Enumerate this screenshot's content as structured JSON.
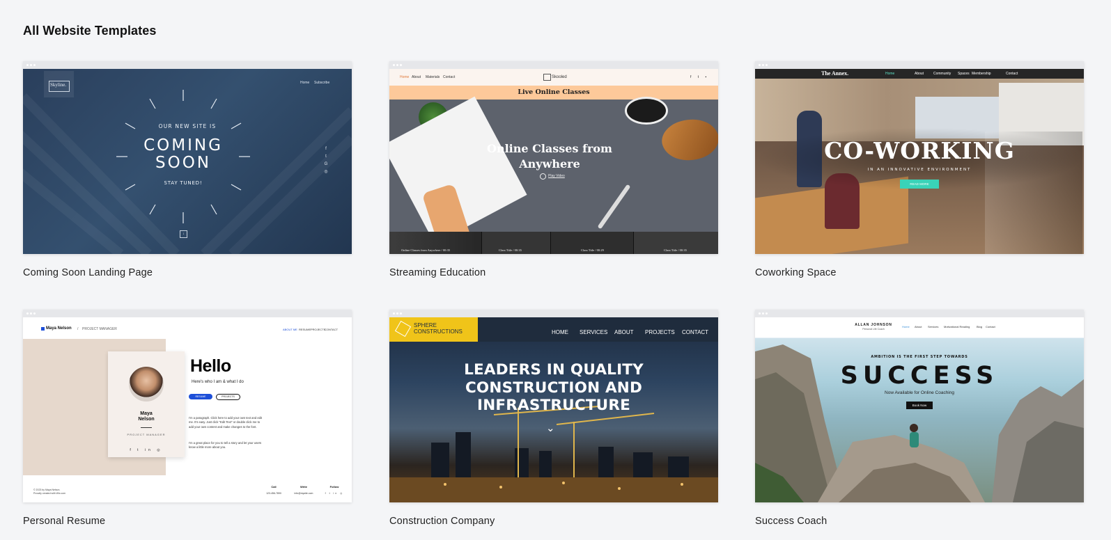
{
  "page": {
    "title": "All Website Templates"
  },
  "templates": [
    {
      "label": "Coming Soon Landing Page",
      "preview": {
        "logo": "Skyline.",
        "nav": [
          "Home",
          "Subscribe"
        ],
        "kicker": "OUR NEW SITE IS",
        "headline": [
          "COMING",
          "SOON"
        ],
        "tagline": "STAY TUNED!",
        "colors": {
          "bg": "#2b4260"
        }
      }
    },
    {
      "label": "Streaming Education",
      "preview": {
        "nav": [
          "Home",
          "About",
          "Materials",
          "Contact"
        ],
        "brand": "Skooled",
        "banner": "Live Online Classes",
        "headline": [
          "Online Classes from",
          "Anywhere"
        ],
        "cta": "Play Video",
        "strip": [
          "Online Classes from Anywhere / 00:35",
          "Class Title / 00:35",
          "Class Title / 00:29",
          "Class Title / 00:35"
        ],
        "colors": {
          "banner": "#fdc99a",
          "bg": "#5d626c"
        }
      }
    },
    {
      "label": "Coworking Space",
      "preview": {
        "brand": "The Annex.",
        "nav": [
          "Home",
          "About",
          "Community",
          "Spaces",
          "Membership",
          "Contact"
        ],
        "headline": "CO-WORKING",
        "subline": "IN AN INNOVATIVE ENVIRONMENT",
        "cta": "READ MORE",
        "colors": {
          "cta": "#3ad3b8"
        }
      }
    },
    {
      "label": "Personal Resume",
      "preview": {
        "name": "Maya Nelson",
        "role": "PROJECT MANAGER",
        "nav": [
          "ABOUT ME",
          "RESUME",
          "PROJECTS",
          "CONTACT"
        ],
        "card_name": [
          "Maya",
          "Nelson"
        ],
        "card_role": "PROJECT MANAGER",
        "hello": "Hello",
        "intro": "Here's who I am & what I do",
        "btn_resume": "RESUME",
        "btn_projects": "PROJECTS",
        "para1": "I'm a paragraph. Click here to add your own text and edit me. It's easy. Just click \"Edit Text\" or double click me to add your own content and make changes to the font.",
        "para2": "I'm a great place for you to tell a story and let your users know a little more about you.",
        "footer_left": [
          "© 2023 by Maya Nelson.",
          "Proudly created with Wix.com"
        ],
        "footer_cols": [
          {
            "title": "Call",
            "value": "123-456-7890"
          },
          {
            "title": "Write",
            "value": "info@mysite.com"
          },
          {
            "title": "Follow",
            "value": ""
          }
        ],
        "colors": {
          "accent": "#1d4fd8"
        }
      }
    },
    {
      "label": "Construction Company",
      "preview": {
        "logo": [
          "SPHERE",
          "CONSTRUCTIONS"
        ],
        "nav": [
          "HOME",
          "SERVICES",
          "ABOUT",
          "PROJECTS",
          "CONTACT"
        ],
        "headline": [
          "LEADERS IN QUALITY",
          "CONSTRUCTION AND",
          "INFRASTRUCTURE"
        ],
        "colors": {
          "logo_bg": "#f0c419",
          "nav_bg": "#1f2c3d"
        }
      }
    },
    {
      "label": "Success Coach",
      "preview": {
        "brand": "ALLAN JOHNSON",
        "brand_sub": "Personal Life Coach",
        "nav": [
          "Home",
          "About",
          "Services",
          "Motivational Reading",
          "Blog",
          "Contact"
        ],
        "kicker": "AMBITION IS THE FIRST STEP TOWARDS",
        "headline": "SUCCESS",
        "subline": "Now Available for Online Coaching",
        "cta": "Book Now"
      }
    }
  ]
}
